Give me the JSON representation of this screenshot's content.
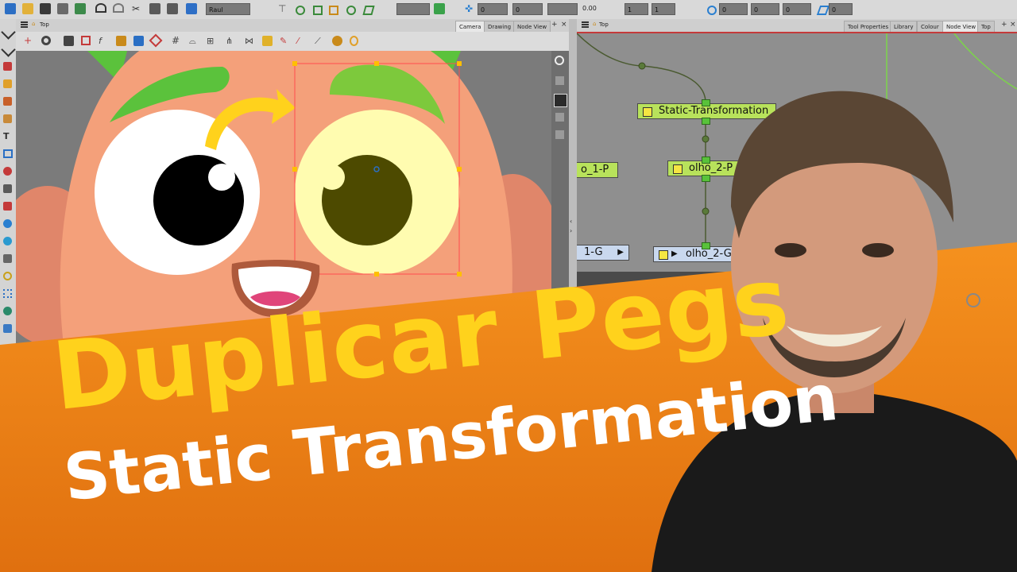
{
  "toolbar": {
    "user_field": "Raul",
    "zoom_value": "0.00",
    "fields": [
      "0",
      "0",
      "1",
      "1",
      "0",
      "0",
      "0",
      "0",
      "0"
    ]
  },
  "camera_panel": {
    "title": "Top",
    "tabs": [
      "Camera",
      "Drawing",
      "Node View"
    ],
    "active_tab": "Camera"
  },
  "node_panel": {
    "title": "Top",
    "tabs": [
      "Tool Properties",
      "Library",
      "Colour",
      "Node View",
      "Top"
    ],
    "active_tab": "Node View",
    "nodes": {
      "static": "Static-Transformation",
      "peg1": "o_1-P",
      "peg2": "olho_2-P",
      "drw1": "1-G",
      "drw2": "olho_2-G"
    }
  },
  "thumbnail": {
    "title": "Duplicar Pegs",
    "subtitle": "Static Transformation"
  },
  "colors": {
    "banner_orange": "#f08a1c",
    "title_yellow": "#ffd21c",
    "skin": "#f4a07a",
    "eyebrow_green": "#5bc23c",
    "peg_node": "#b8e25b",
    "drawing_node": "#c9d8ee"
  }
}
